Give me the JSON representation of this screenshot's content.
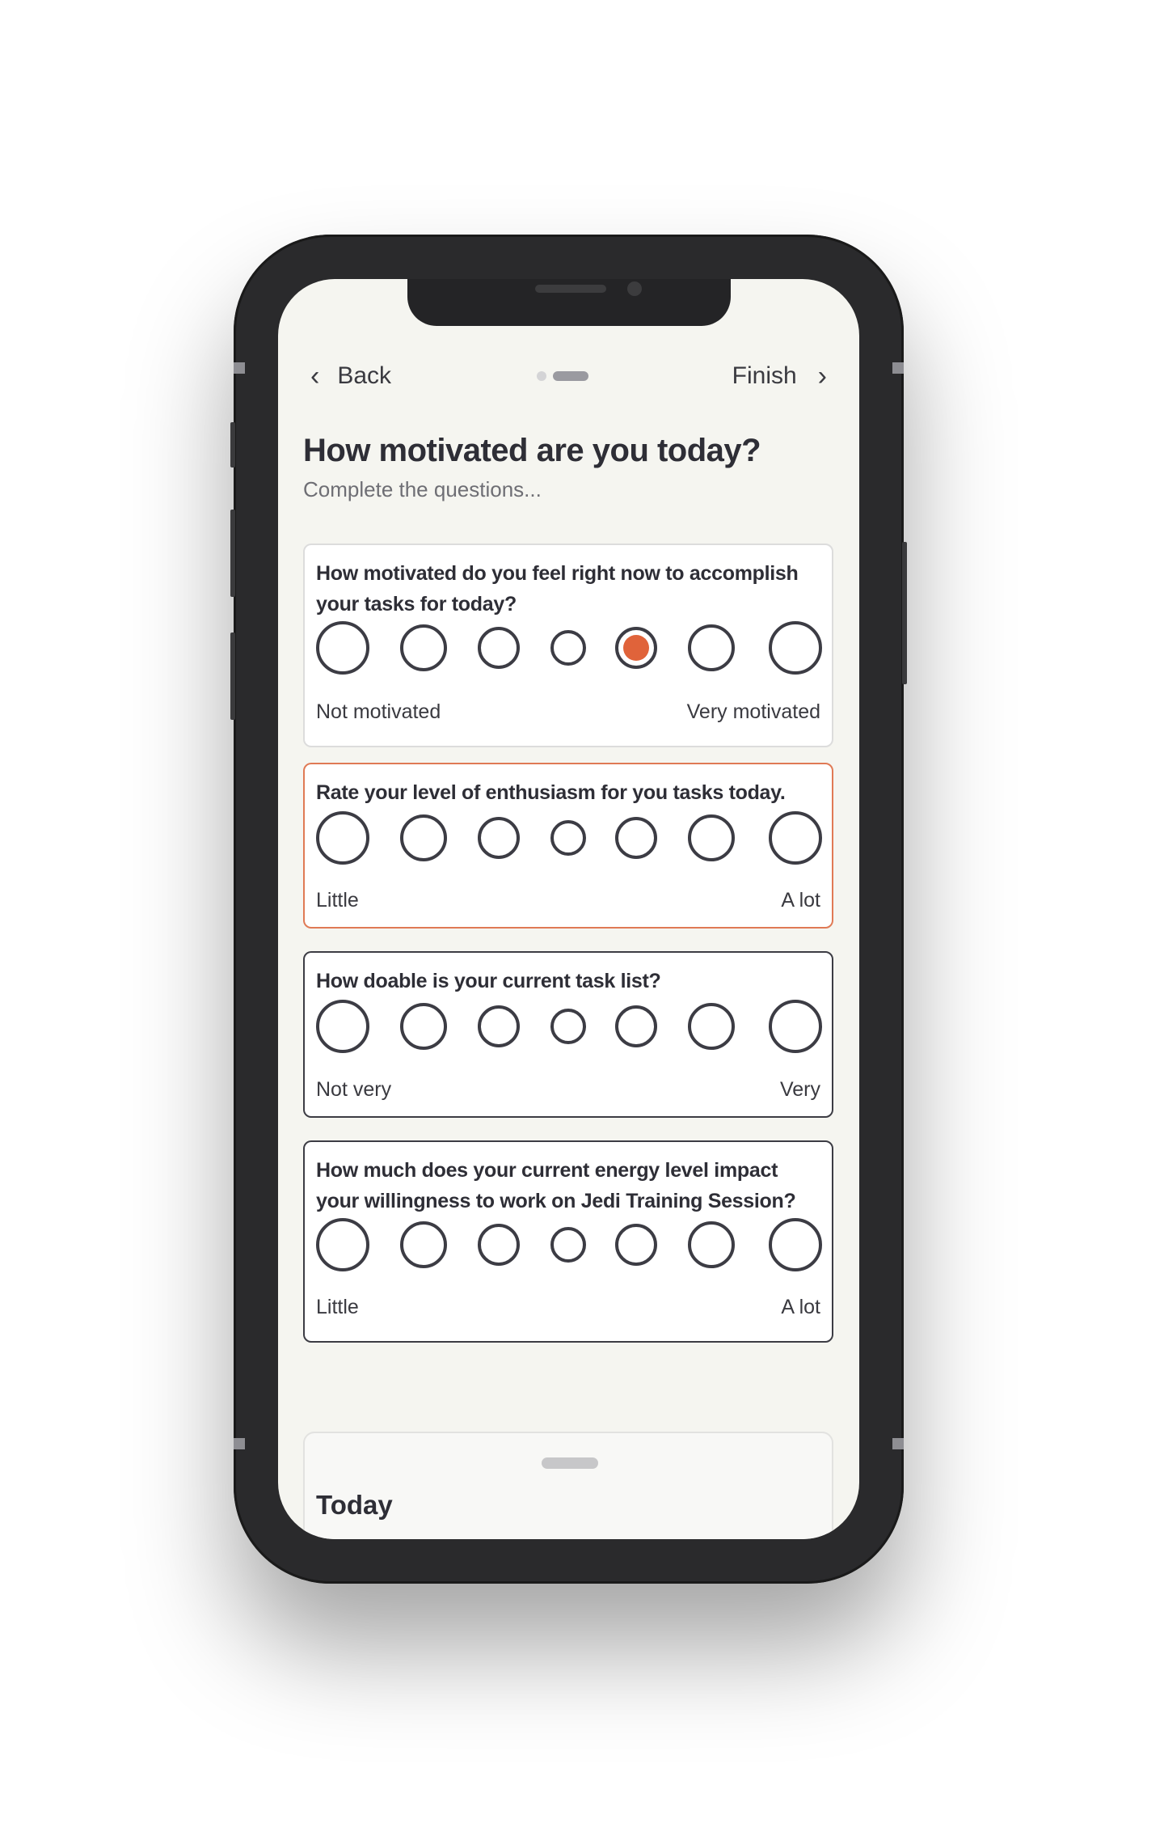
{
  "nav": {
    "back_label": "Back",
    "finish_label": "Finish"
  },
  "header": {
    "title": "How motivated are you today?",
    "subtitle": "Complete the questions..."
  },
  "questions": [
    {
      "text": "How motivated do you feel right now to accomplish your tasks for today?",
      "left_label": "Not motivated",
      "right_label": "Very motivated",
      "scale_points": 7,
      "selected_point": 5
    },
    {
      "text": "Rate your level of enthusiasm for you tasks today.",
      "left_label": "Little",
      "right_label": "A lot",
      "scale_points": 7,
      "selected_point": null
    },
    {
      "text": "How doable is your current task list?",
      "left_label": "Not very",
      "right_label": "Very",
      "scale_points": 7,
      "selected_point": null
    },
    {
      "text": "How much does your current energy level impact your willingness to work on Jedi Training Session?",
      "left_label": "Little",
      "right_label": "A lot",
      "scale_points": 7,
      "selected_point": null
    }
  ],
  "sheet": {
    "title": "Today"
  },
  "colors": {
    "accent": "#e0633a",
    "highlight_border": "#e07a55",
    "text": "#2e2e36",
    "background": "#f5f5f0"
  },
  "icons": {
    "back": "chevron-left-icon",
    "finish": "chevron-right-icon"
  }
}
